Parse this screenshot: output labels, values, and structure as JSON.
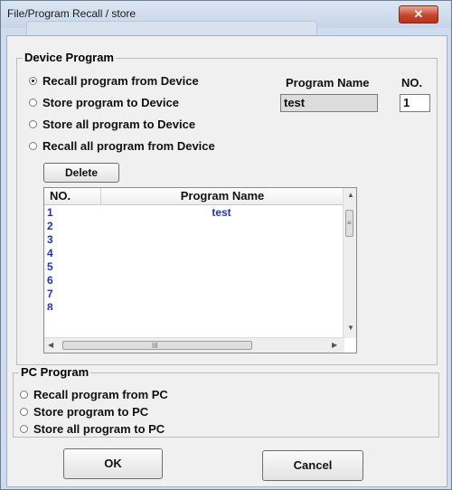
{
  "window": {
    "title": "File/Program Recall / store",
    "close_glyph": "✕"
  },
  "device_program": {
    "legend": "Device Program",
    "radios": [
      {
        "label": "Recall program from Device",
        "checked": true
      },
      {
        "label": "Store program to Device",
        "checked": false
      },
      {
        "label": "Store all program to Device",
        "checked": false
      },
      {
        "label": "Recall all program from Device",
        "checked": false
      }
    ],
    "program_name_label": "Program Name",
    "program_name_value": "test",
    "no_label": "NO.",
    "no_value": "1",
    "delete_label": "Delete"
  },
  "program_list": {
    "columns": [
      "NO.",
      "Program Name"
    ],
    "rows": [
      {
        "no": "1",
        "name": "test"
      },
      {
        "no": "2",
        "name": ""
      },
      {
        "no": "3",
        "name": ""
      },
      {
        "no": "4",
        "name": ""
      },
      {
        "no": "5",
        "name": ""
      },
      {
        "no": "6",
        "name": ""
      },
      {
        "no": "7",
        "name": ""
      },
      {
        "no": "8",
        "name": ""
      }
    ],
    "hscroll_grip": "III",
    "vscroll_grip": "≡"
  },
  "pc_program": {
    "legend": "PC Program",
    "radios": [
      {
        "label": "Recall program from PC",
        "checked": false
      },
      {
        "label": "Store program to PC",
        "checked": false
      },
      {
        "label": "Store all program to PC",
        "checked": false
      }
    ]
  },
  "buttons": {
    "ok": "OK",
    "cancel": "Cancel"
  },
  "colors": {
    "row_text": "#1f30d8",
    "close_button": "#c7452a",
    "frame": "#cfdced"
  }
}
